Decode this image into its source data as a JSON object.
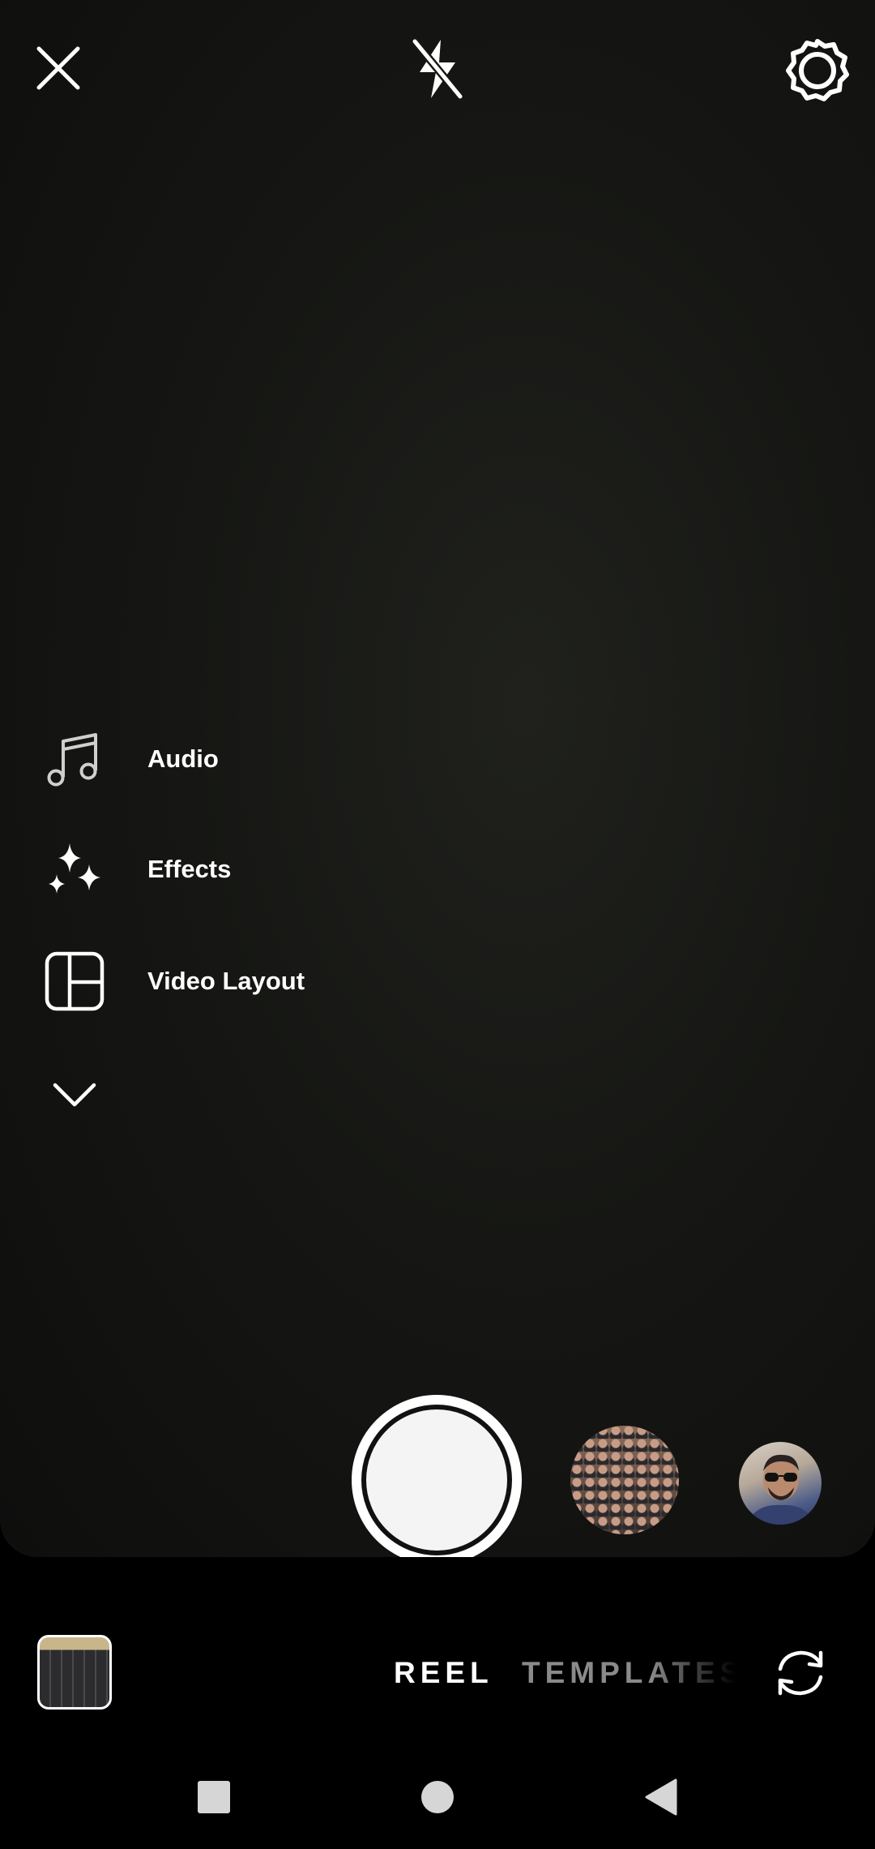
{
  "top_bar": {
    "close_icon": "close-icon",
    "flash_icon": "flash-off-icon",
    "settings_icon": "gear-icon"
  },
  "tools": [
    {
      "label": "Audio",
      "icon": "music-note-icon"
    },
    {
      "label": "Effects",
      "icon": "sparkles-icon"
    },
    {
      "label": "Video Layout",
      "icon": "layout-grid-icon"
    }
  ],
  "more_tools_icon": "chevron-down-icon",
  "capture": {
    "shutter_icon": "shutter-button",
    "effects": [
      {
        "icon": "effect-pattern-thumbnail"
      },
      {
        "icon": "effect-avatar-thumbnail"
      }
    ]
  },
  "bottom": {
    "gallery_icon": "gallery-thumbnail",
    "modes": [
      "REEL",
      "TEMPLATES"
    ],
    "active_mode": "REEL",
    "flip_icon": "flip-camera-icon"
  },
  "nav": {
    "recent_icon": "recent-apps-icon",
    "home_icon": "home-icon",
    "back_icon": "back-icon"
  },
  "colors": {
    "background": "#000000",
    "viewfinder": "#161714",
    "text_primary": "#ffffff",
    "text_inactive": "#8a8a8a"
  }
}
